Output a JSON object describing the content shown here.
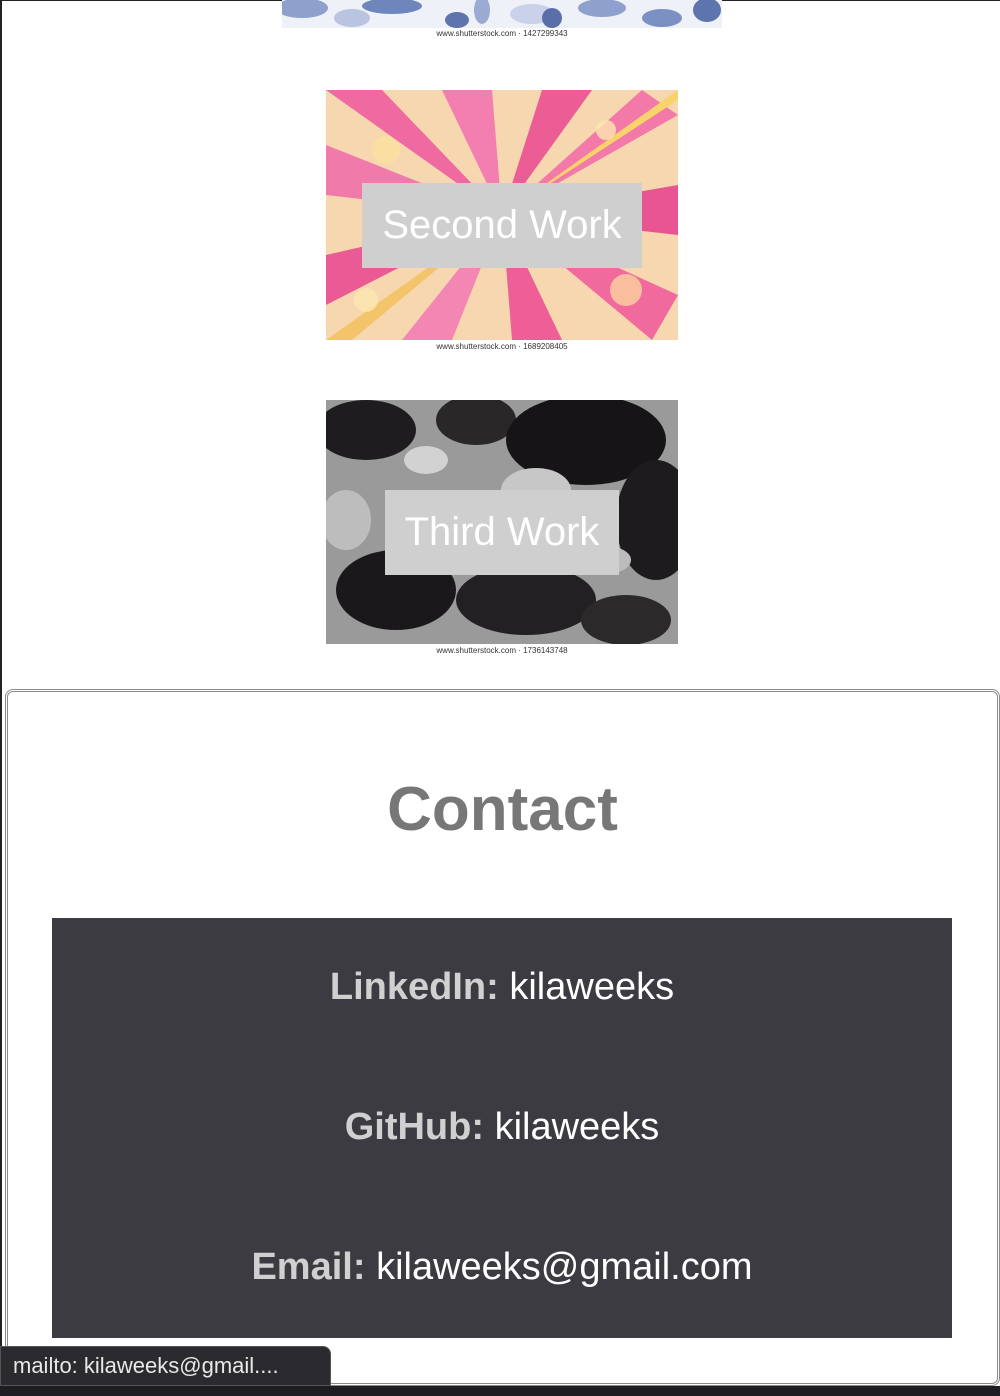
{
  "works": [
    {
      "id": "first",
      "label": "",
      "caption": "www.shutterstock.com · 1427299343"
    },
    {
      "id": "second",
      "label": "Second Work",
      "caption": "www.shutterstock.com · 1689208405"
    },
    {
      "id": "third",
      "label": "Third Work",
      "caption": "www.shutterstock.com · 1736143748"
    }
  ],
  "contact": {
    "title": "Contact",
    "linkedin_label": "LinkedIn:",
    "linkedin_value": "kilaweeks",
    "github_label": "GitHub:",
    "github_value": "kilaweeks",
    "email_label": "Email:",
    "email_value": "kilaweeks@gmail.com"
  },
  "status_bar": {
    "text": "mailto: kilaweeks@gmail...."
  },
  "colors": {
    "panel_bg": "#3b3b41",
    "label_box": "#cfcfcf",
    "title_gray": "#777777"
  }
}
